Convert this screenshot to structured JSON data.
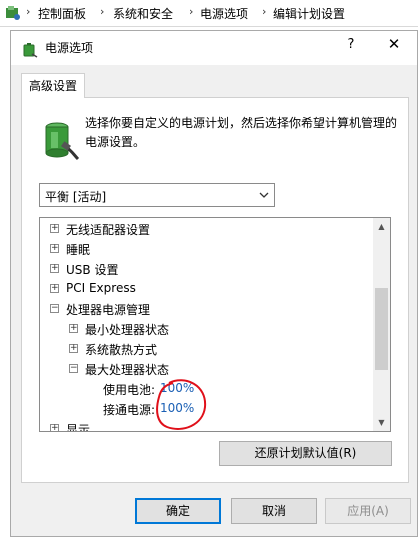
{
  "breadcrumb": {
    "items": [
      "控制面板",
      "系统和安全",
      "电源选项",
      "编辑计划设置"
    ],
    "separator": "›"
  },
  "dialog": {
    "title": "电源选项",
    "help_label": "?",
    "close_label": "✕",
    "tab_label": "高级设置",
    "description": "选择你要自定义的电源计划，然后选择你希望计算机管理的电源设置。",
    "plan_select": {
      "value": "平衡 [活动]"
    },
    "tree": [
      {
        "expander": "+",
        "label": "无线适配器设置"
      },
      {
        "expander": "+",
        "label": "睡眠"
      },
      {
        "expander": "+",
        "label": "USB 设置"
      },
      {
        "expander": "+",
        "label": "PCI Express"
      },
      {
        "expander": "−",
        "label": "处理器电源管理"
      },
      {
        "expander": "+",
        "label": "最小处理器状态"
      },
      {
        "expander": "+",
        "label": "系统散热方式"
      },
      {
        "expander": "−",
        "label": "最大处理器状态"
      },
      {
        "label": "使用电池:",
        "value": "100%"
      },
      {
        "label": "接通电源:",
        "value": "100%"
      },
      {
        "expander": "+",
        "label": "显示"
      }
    ],
    "restore_label": "还原计划默认值(R)",
    "ok_label": "确定",
    "cancel_label": "取消",
    "apply_label": "应用(A)"
  },
  "colors": {
    "link_value": "#1a5fb4",
    "annotation": "#e0101a",
    "ok_border": "#0078d7"
  }
}
